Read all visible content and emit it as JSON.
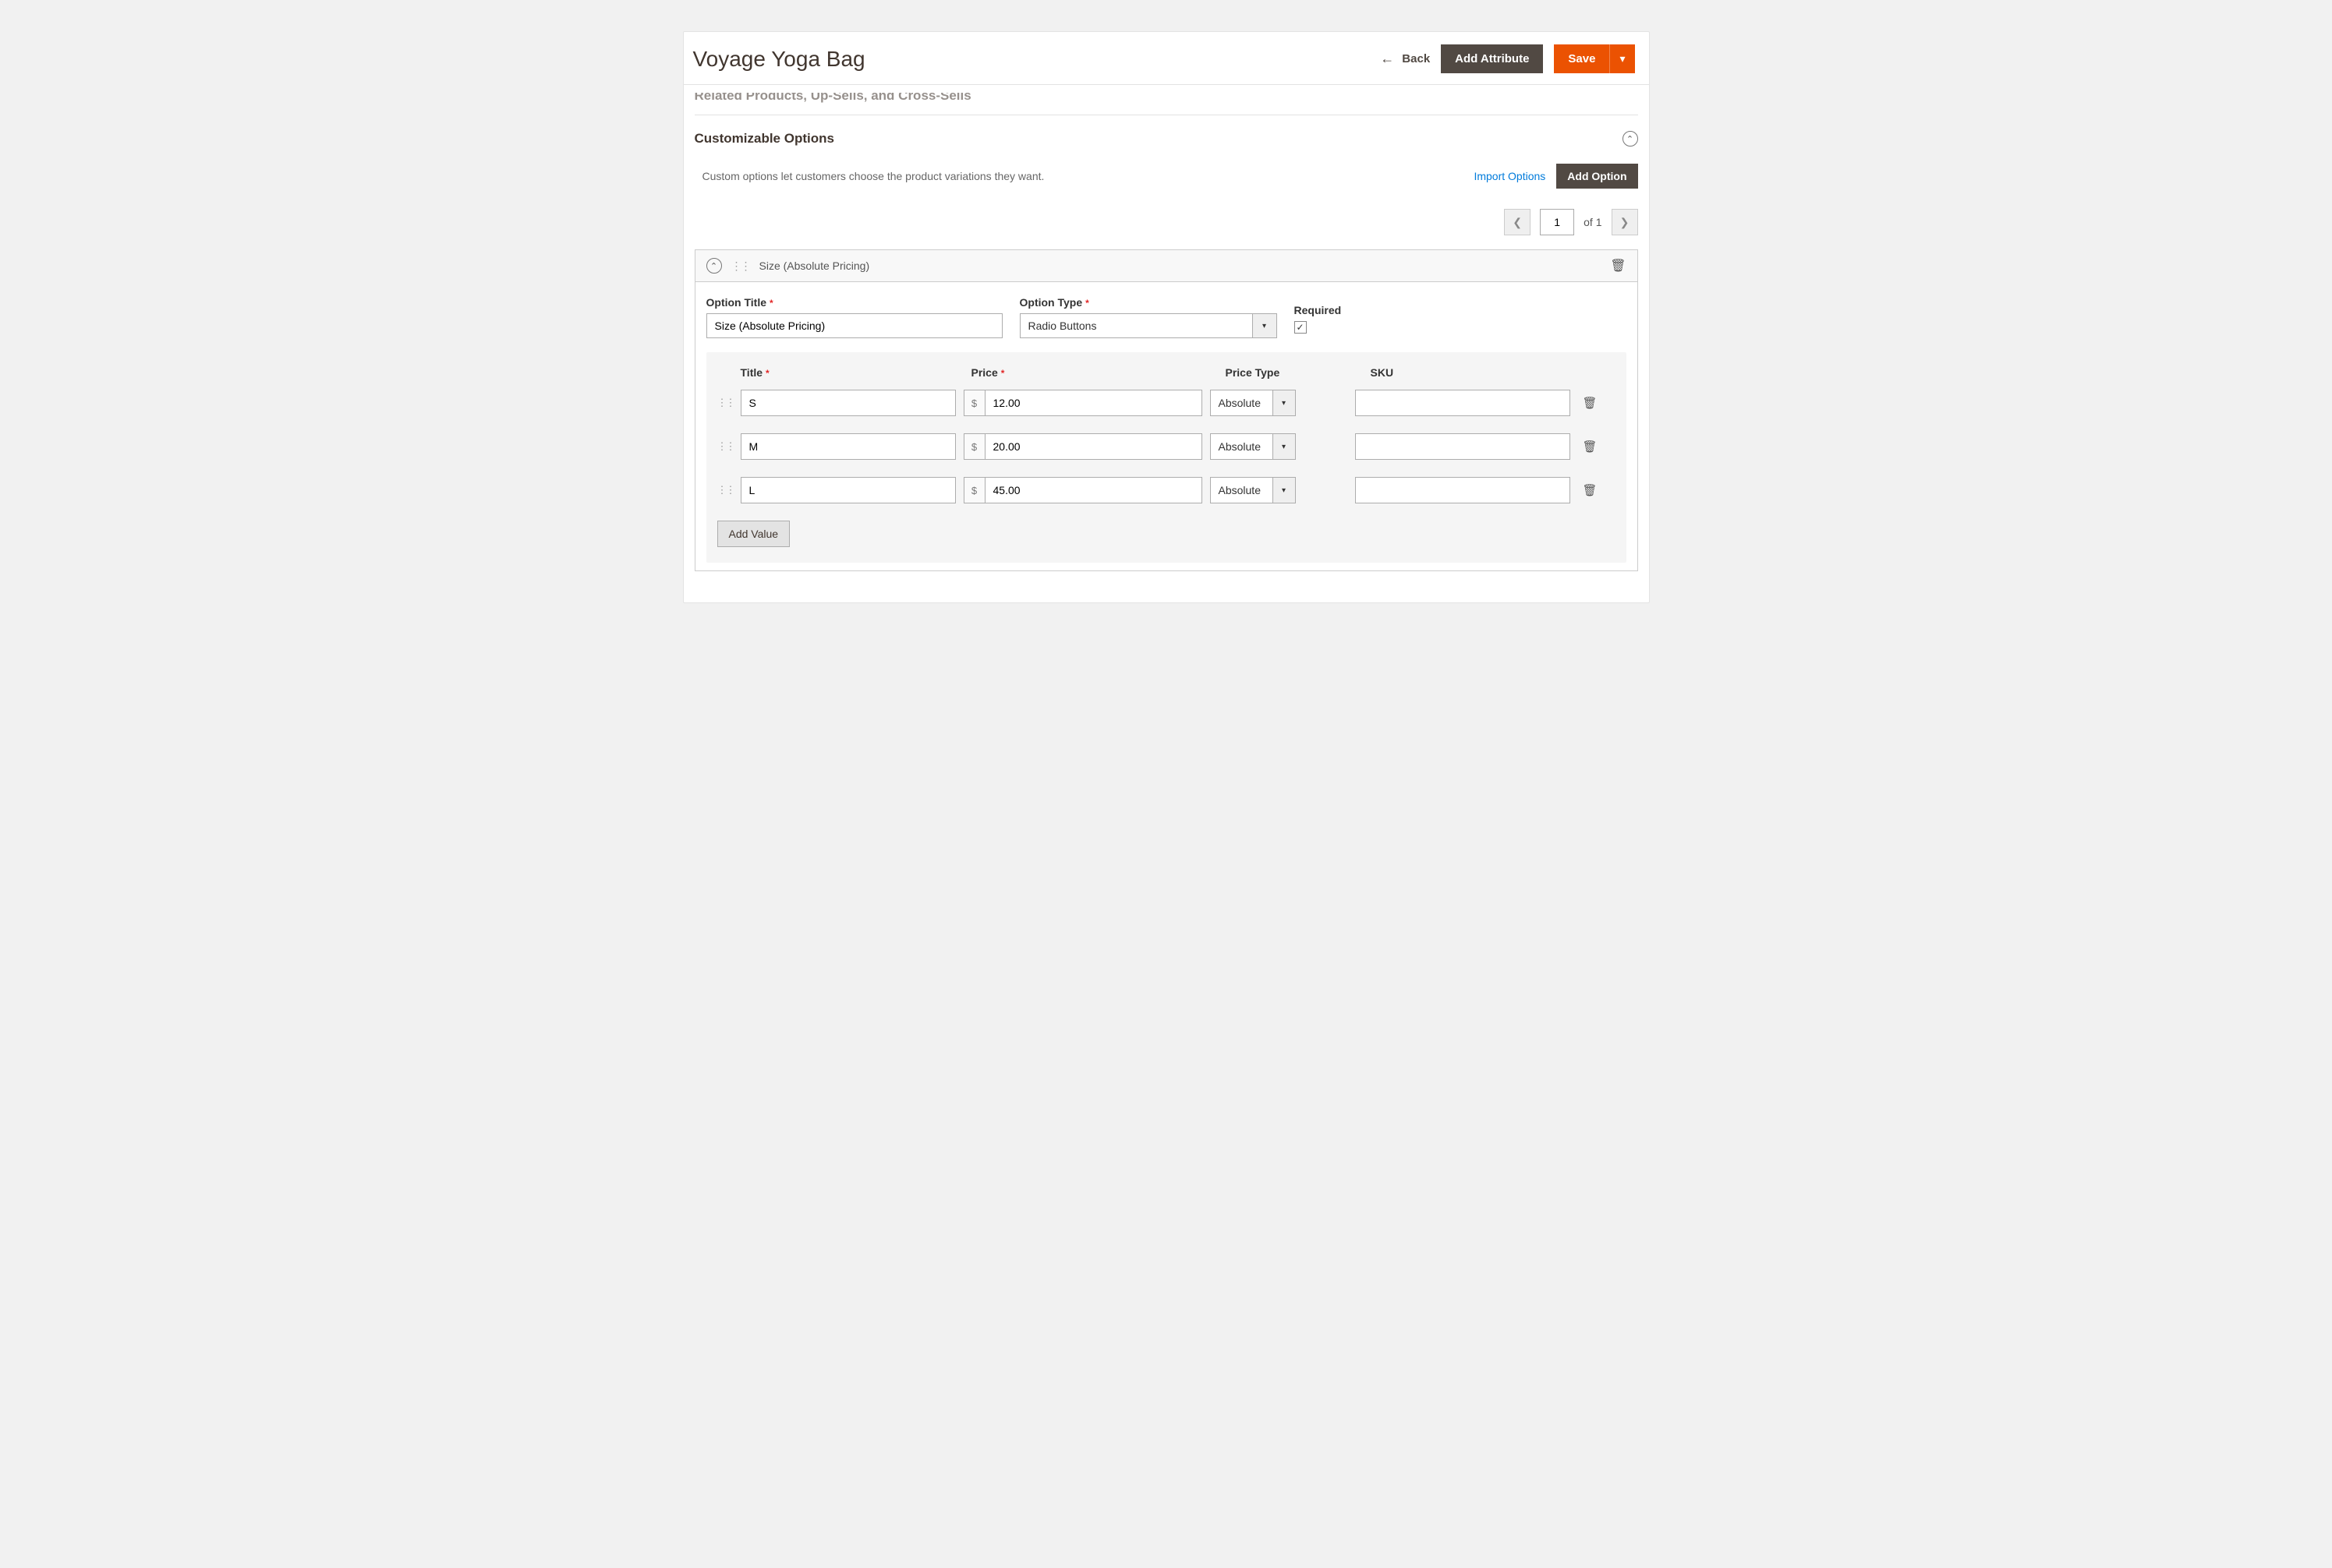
{
  "header": {
    "page_title": "Voyage Yoga Bag",
    "back_label": "Back",
    "add_attribute_label": "Add Attribute",
    "save_label": "Save"
  },
  "section_cut_title": "Related Products, Up-Sells, and Cross-Sells",
  "customizable": {
    "title": "Customizable Options",
    "description": "Custom options let customers choose the product variations they want.",
    "import_label": "Import Options",
    "add_option_label": "Add Option",
    "pager": {
      "page": "1",
      "total_text": "of 1"
    }
  },
  "option": {
    "header_name": "Size (Absolute Pricing)",
    "title_label": "Option Title",
    "title_value": "Size (Absolute Pricing)",
    "type_label": "Option Type",
    "type_value": "Radio Buttons",
    "required_label": "Required",
    "required_checked": "✓",
    "columns": {
      "title": "Title",
      "price": "Price",
      "price_type": "Price Type",
      "sku": "SKU"
    },
    "currency": "$",
    "rows": [
      {
        "title": "S",
        "price": "12.00",
        "price_type": "Absolute",
        "sku": ""
      },
      {
        "title": "M",
        "price": "20.00",
        "price_type": "Absolute",
        "sku": ""
      },
      {
        "title": "L",
        "price": "45.00",
        "price_type": "Absolute",
        "sku": ""
      }
    ],
    "add_value_label": "Add Value"
  }
}
